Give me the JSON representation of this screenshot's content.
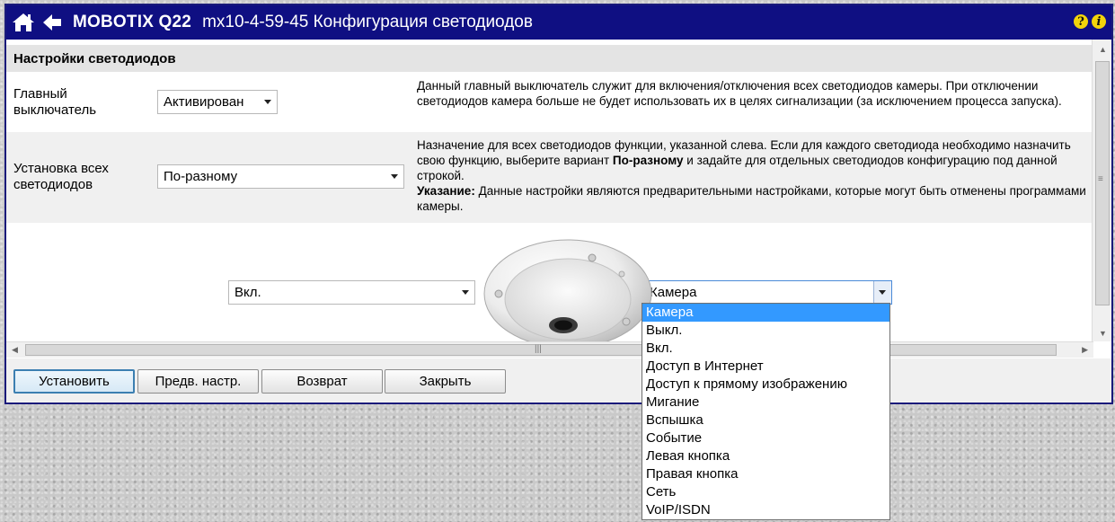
{
  "titlebar": {
    "brand": "MOBOTIX Q22",
    "subtitle": "mx10-4-59-45 Конфигурация светодиодов",
    "icons": [
      "home-icon",
      "back-arrow-icon",
      "help-icon",
      "info-icon"
    ],
    "help_glyph": "?",
    "info_glyph": "i"
  },
  "section": {
    "title": "Настройки светодиодов"
  },
  "rows": [
    {
      "label_line1": "Главный",
      "label_line2": "выключатель",
      "select_value": "Активирован",
      "desc": "Данный главный выключатель служит для включения/отключения всех светодиодов камеры. При отключении светодиодов камера больше не будет использовать их в целях сигнализации (за исключением процесса запуска)."
    },
    {
      "label_line1": "Установка всех",
      "label_line2": "светодиодов",
      "select_value": "По-разному",
      "desc_part1": "Назначение для всех светодиодов функции, указанной слева. Если для каждого светодиода необходимо назначить свою функцию, выберите вариант ",
      "desc_bold": "По-разному",
      "desc_part2": " и задайте для отдельных светодиодов конфигурацию под данной строкой.",
      "note_label": "Указание:",
      "note_text": " Данные настройки являются предварительными настройками, которые могут быть отменены программами камеры."
    }
  ],
  "led": {
    "left_select": "Вкл.",
    "right_select": "Камера",
    "options": [
      "Камера",
      "Выкл.",
      "Вкл.",
      "Доступ в Интернет",
      "Доступ к прямому изображению",
      "Мигание",
      "Вспышка",
      "Событие",
      "Левая кнопка",
      "Правая кнопка",
      "Сеть",
      "VoIP/ISDN"
    ],
    "selected_index": 0
  },
  "buttons": {
    "set": "Установить",
    "presets": "Предв. настр.",
    "restore": "Возврат",
    "close": "Закрыть"
  },
  "colors": {
    "titlebar": "#0f0f82",
    "highlight": "#3399ff",
    "help_icon": "#f2d40b"
  }
}
